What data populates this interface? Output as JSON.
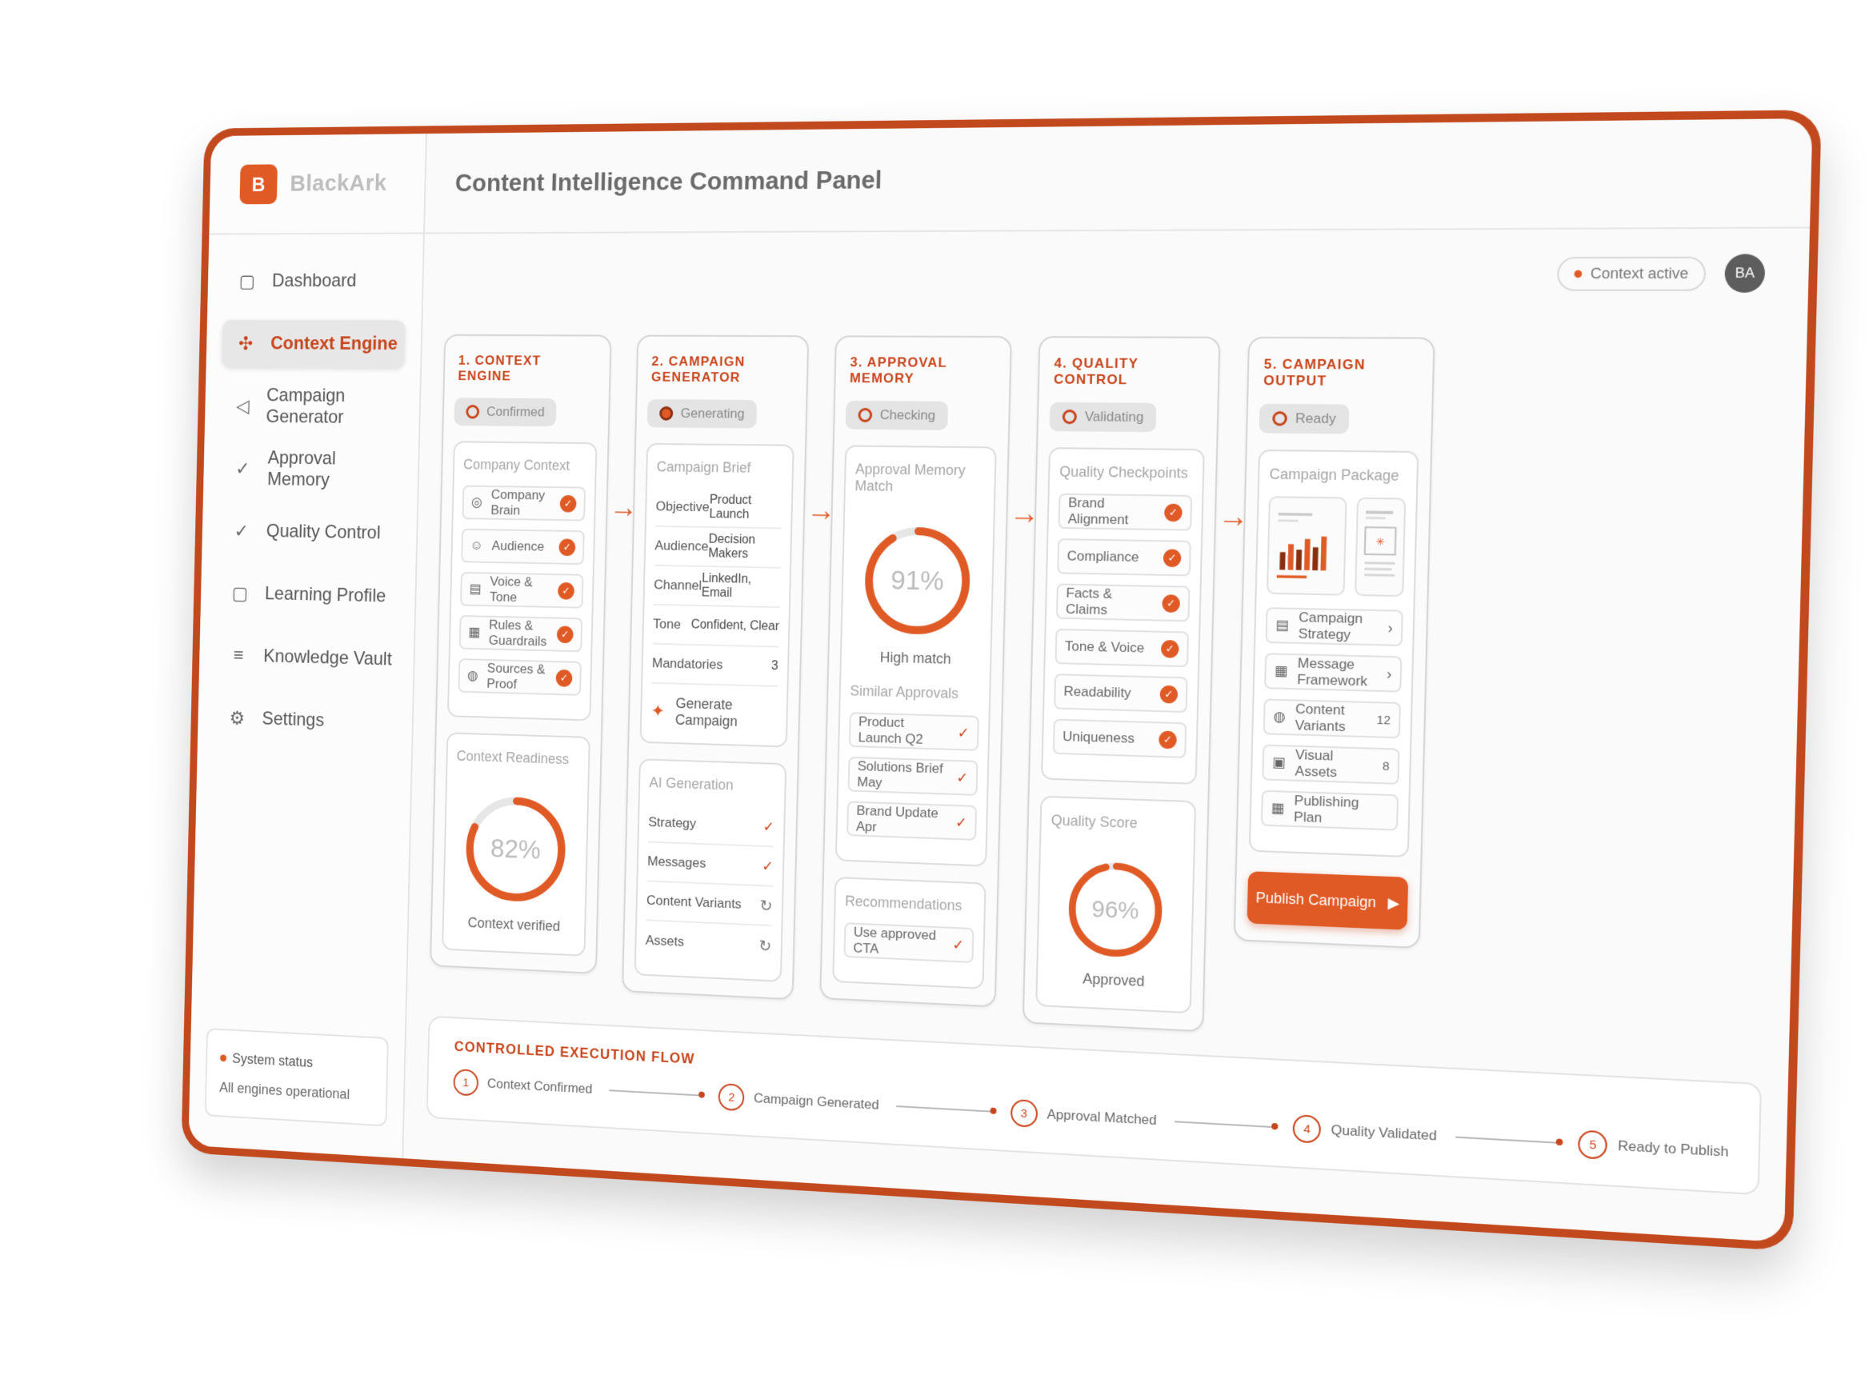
{
  "brand": {
    "logo_letter": "B",
    "name": "BlackArk"
  },
  "header": {
    "title": "Content Intelligence Command Panel"
  },
  "top_right": {
    "context_status": "Context active",
    "avatar_initials": "BA"
  },
  "nav": [
    {
      "label": "Dashboard",
      "icon": "dashboard-icon",
      "active": false
    },
    {
      "label": "Context Engine",
      "icon": "context-engine-icon",
      "active": true
    },
    {
      "label": "Campaign Generator",
      "icon": "megaphone-icon",
      "active": false
    },
    {
      "label": "Approval Memory",
      "icon": "check-circle-icon",
      "active": false
    },
    {
      "label": "Quality Control",
      "icon": "check-circle-icon",
      "active": false
    },
    {
      "label": "Learning Profile",
      "icon": "profile-icon",
      "active": false
    },
    {
      "label": "Knowledge Vault",
      "icon": "database-icon",
      "active": false
    },
    {
      "label": "Settings",
      "icon": "gear-icon",
      "active": false
    }
  ],
  "system_status": {
    "title": "System status",
    "text": "All engines operational"
  },
  "context_engine": {
    "title": "1. Context Engine",
    "badge": "Confirmed",
    "company_context": {
      "title": "Company Context",
      "items": [
        "Company Brain",
        "Audience",
        "Voice & Tone",
        "Rules & Guardrails",
        "Sources & Proof"
      ]
    },
    "readiness": {
      "title": "Context Readiness",
      "value": "82%",
      "percent": 82,
      "caption": "Context verified"
    }
  },
  "campaign_generator": {
    "title": "2. Campaign Generator",
    "badge": "Generating",
    "brief": {
      "title": "Campaign Brief",
      "rows": [
        {
          "k": "Objective",
          "v": "Product Launch"
        },
        {
          "k": "Audience",
          "v": "Decision Makers"
        },
        {
          "k": "Channel",
          "v": "LinkedIn, Email"
        },
        {
          "k": "Tone",
          "v": "Confident, Clear"
        },
        {
          "k": "Mandatories",
          "v": "3"
        }
      ],
      "action": "Generate Campaign"
    },
    "ai_generation": {
      "title": "AI Generation",
      "rows": [
        {
          "k": "Strategy",
          "state": "done"
        },
        {
          "k": "Messages",
          "state": "done"
        },
        {
          "k": "Content Variants",
          "state": "pending"
        },
        {
          "k": "Assets",
          "state": "pending"
        }
      ]
    }
  },
  "approval_memory": {
    "title": "3. Approval Memory",
    "badge": "Checking",
    "match": {
      "title": "Approval Memory Match",
      "value": "91%",
      "percent": 91,
      "caption": "High match"
    },
    "similar": {
      "title": "Similar Approvals",
      "items": [
        "Product Launch Q2",
        "Solutions Brief May",
        "Brand Update Apr"
      ]
    },
    "recommendations": {
      "title": "Recommendations",
      "items": [
        "Use approved CTA"
      ]
    }
  },
  "quality_control": {
    "title": "4. Quality Control",
    "badge": "Validating",
    "checkpoints": {
      "title": "Quality Checkpoints",
      "items": [
        "Brand Alignment",
        "Compliance",
        "Facts & Claims",
        "Tone & Voice",
        "Readability",
        "Uniqueness"
      ]
    },
    "score": {
      "title": "Quality Score",
      "value": "96%",
      "percent": 96,
      "caption": "Approved"
    }
  },
  "campaign_output": {
    "title": "5. Campaign Output",
    "badge": "Ready",
    "package": {
      "title": "Campaign Package",
      "items": [
        {
          "label": "Campaign Strategy",
          "meta": "›"
        },
        {
          "label": "Message Framework",
          "meta": "›"
        },
        {
          "label": "Content Variants",
          "meta": "12"
        },
        {
          "label": "Visual Assets",
          "meta": "8"
        },
        {
          "label": "Publishing Plan",
          "meta": ""
        }
      ]
    },
    "publish_button": "Publish Campaign"
  },
  "flow": {
    "title": "Controlled Execution Flow",
    "steps": [
      {
        "num": "1",
        "label": "Context Confirmed"
      },
      {
        "num": "2",
        "label": "Campaign Generated"
      },
      {
        "num": "3",
        "label": "Approval Matched"
      },
      {
        "num": "4",
        "label": "Quality Validated"
      },
      {
        "num": "5",
        "label": "Ready to Publish"
      }
    ]
  },
  "colors": {
    "accent": "#e05a26",
    "frame": "#c2491e",
    "text": "#4a4a4a"
  }
}
